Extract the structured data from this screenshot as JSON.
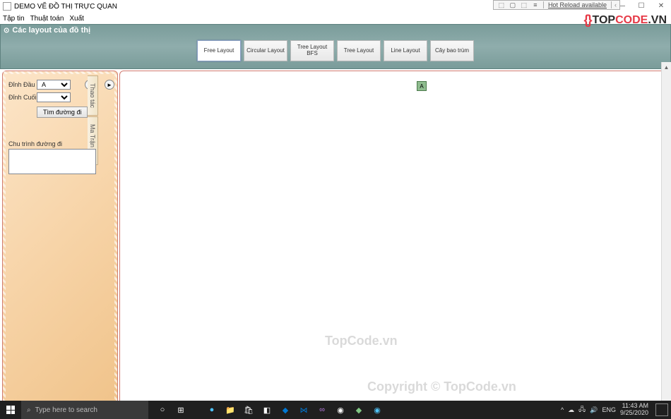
{
  "debug": {
    "hot_reload": "Hot Reload available",
    "arrow": "‹"
  },
  "window": {
    "title": "DEMO VẼ ĐỒ THỊ TRỰC QUAN"
  },
  "menu": {
    "file": "Tập tin",
    "algorithm": "Thuật toán",
    "export": "Xuất"
  },
  "layout_panel": {
    "title": "Các layout của đồ thị",
    "buttons": {
      "free": "Free Layout",
      "circular": "Circular Layout",
      "tree_bfs": "Tree Layout BFS",
      "tree": "Tree Layout",
      "line": "Line Layout",
      "spanning": "Cây bao trùm"
    }
  },
  "side_tabs": {
    "thao_tac": "Thao tác",
    "ma_tran": "Ma Trận Kề"
  },
  "left_panel": {
    "start_label": "Đỉnh Đầu",
    "end_label": "Đỉnh Cuối",
    "start_value": "A",
    "end_value": "",
    "find_btn": "Tìm đường đi",
    "cycle_label": "Chu trình đường đi"
  },
  "canvas": {
    "node_a": "A",
    "watermark1": "TopCode.vn",
    "watermark2": "Copyright © TopCode.vn"
  },
  "logo": {
    "brackets": "{}",
    "text_top": "TOP",
    "text_code": "CODE",
    "text_vn": ".VN"
  },
  "taskbar": {
    "search_placeholder": "Type here to search",
    "lang": "ENG",
    "time": "11:43 AM",
    "date": "9/25/2020"
  }
}
